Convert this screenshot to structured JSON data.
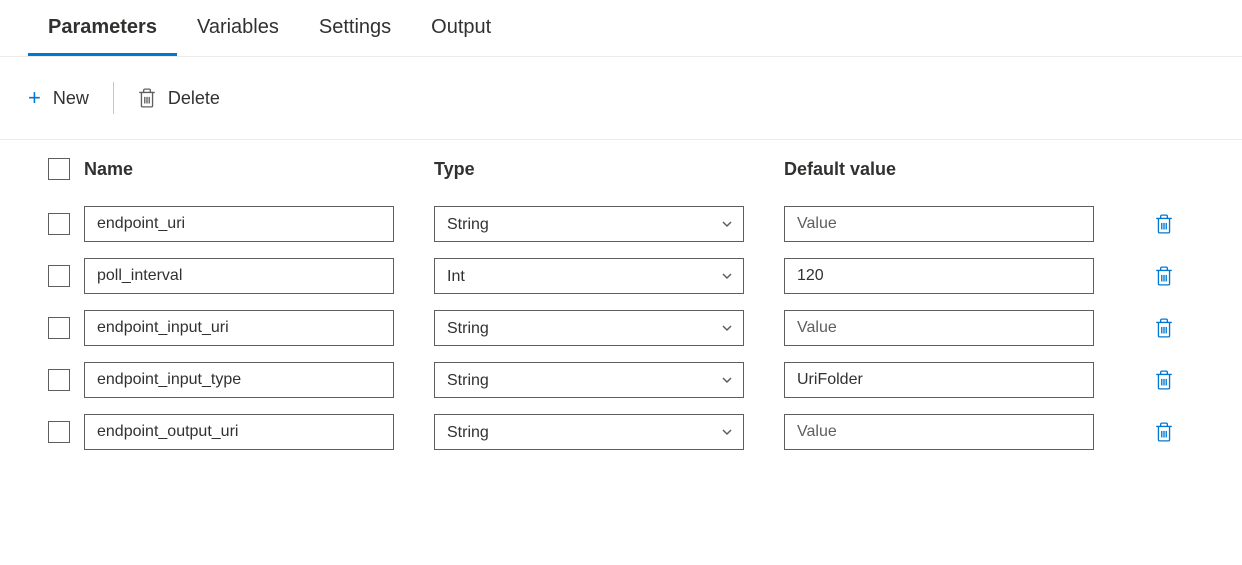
{
  "tabs": {
    "items": [
      {
        "label": "Parameters",
        "active": true
      },
      {
        "label": "Variables",
        "active": false
      },
      {
        "label": "Settings",
        "active": false
      },
      {
        "label": "Output",
        "active": false
      }
    ]
  },
  "toolbar": {
    "new_label": "New",
    "delete_label": "Delete"
  },
  "columns": {
    "name": "Name",
    "type": "Type",
    "default_value": "Default value"
  },
  "rows": [
    {
      "name": "endpoint_uri",
      "type": "String",
      "value": "",
      "placeholder": "Value"
    },
    {
      "name": "poll_interval",
      "type": "Int",
      "value": "120",
      "placeholder": "Value"
    },
    {
      "name": "endpoint_input_uri",
      "type": "String",
      "value": "",
      "placeholder": "Value"
    },
    {
      "name": "endpoint_input_type",
      "type": "String",
      "value": "UriFolder",
      "placeholder": "Value"
    },
    {
      "name": "endpoint_output_uri",
      "type": "String",
      "value": "",
      "placeholder": "Value"
    }
  ]
}
